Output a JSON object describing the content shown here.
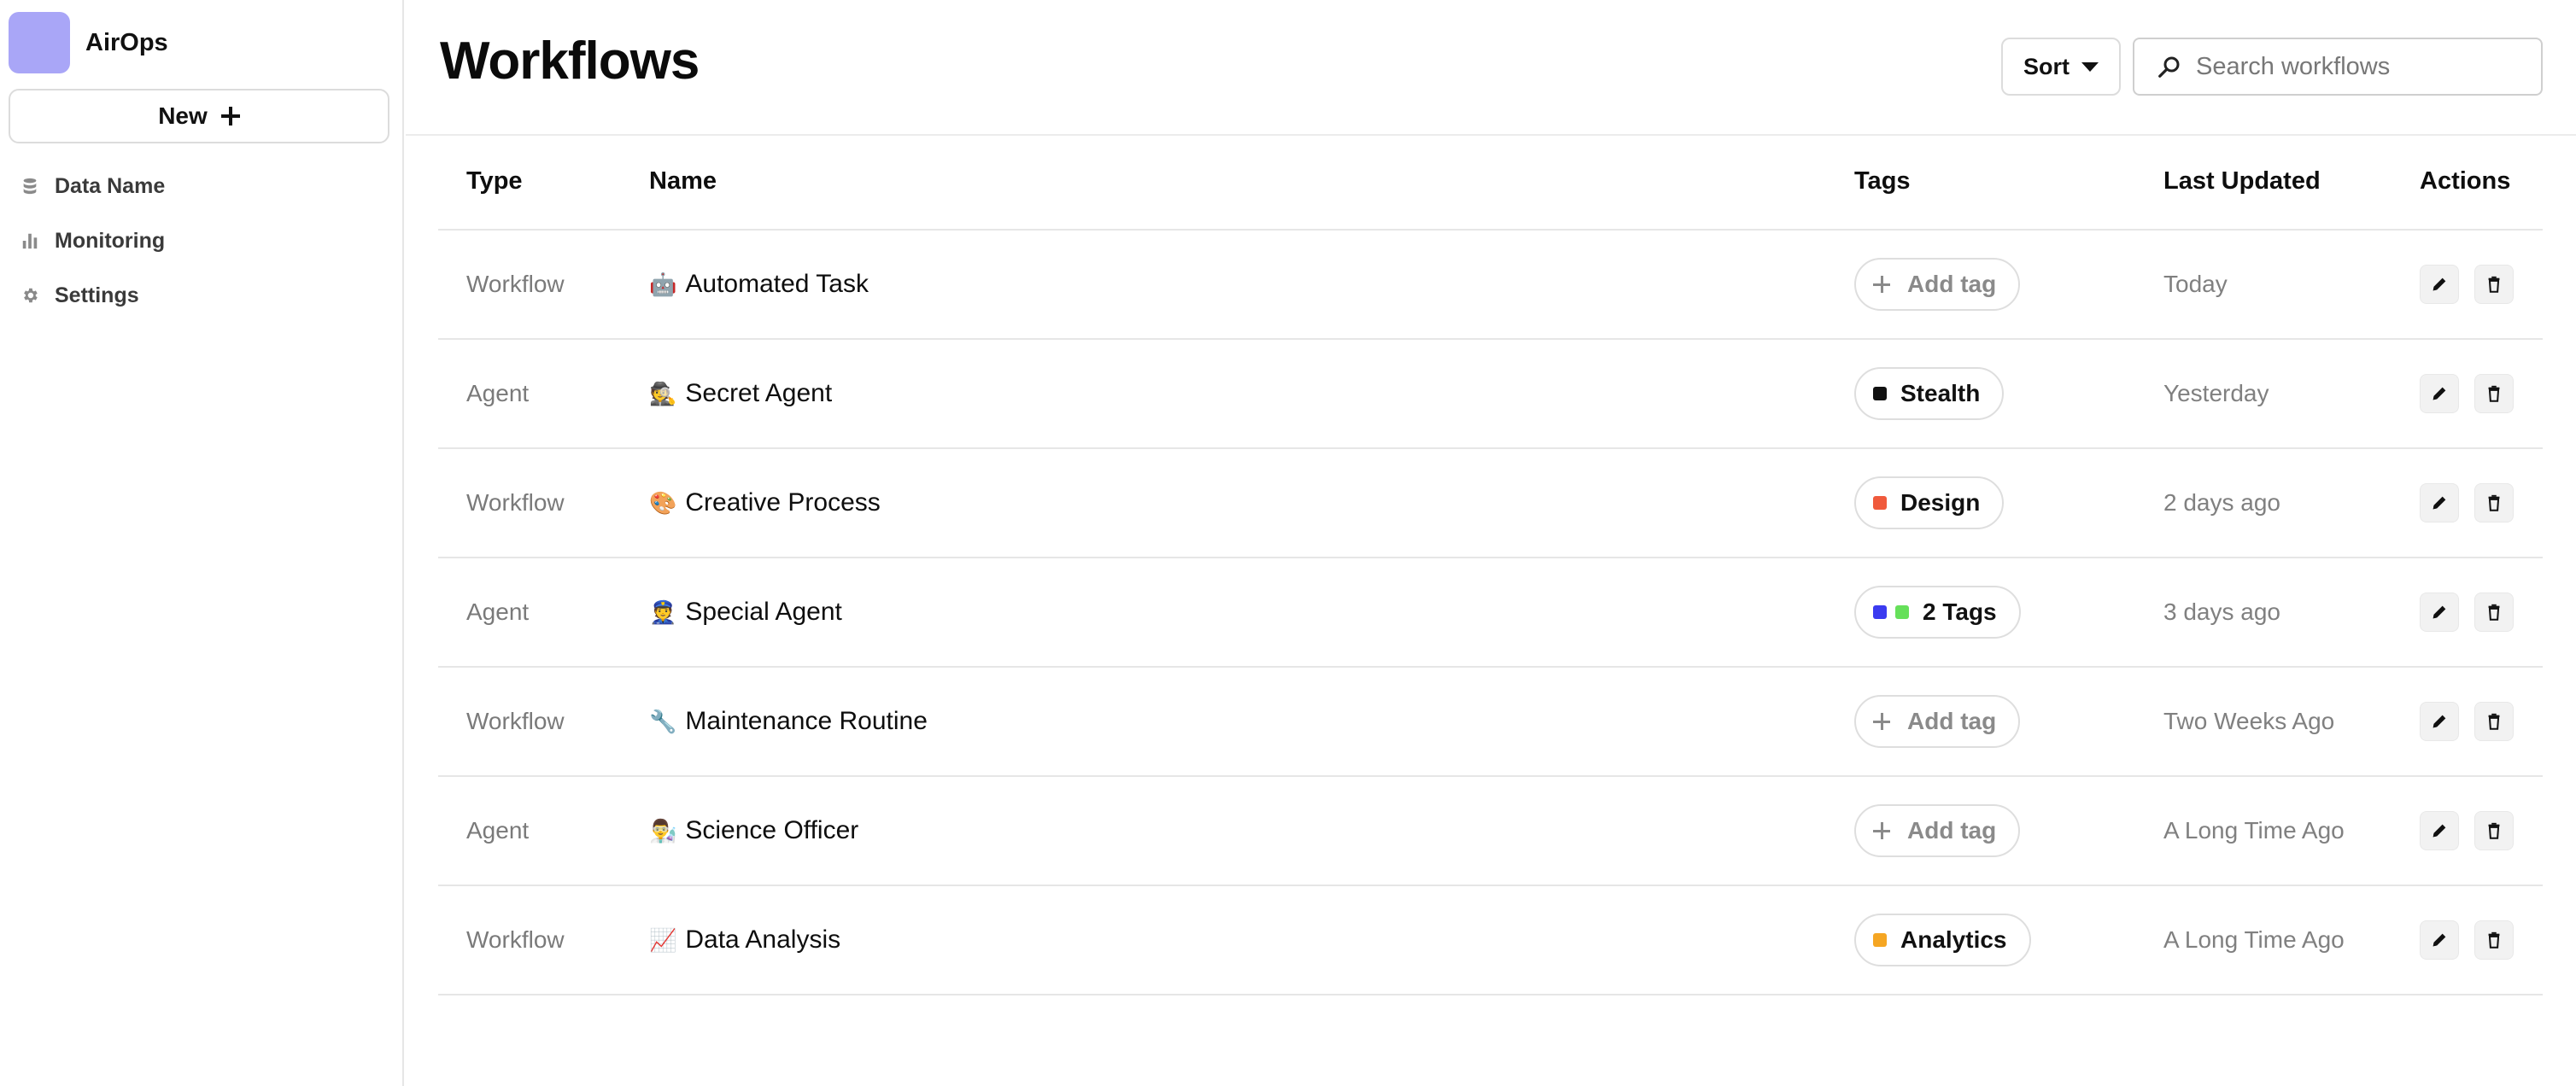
{
  "brand": {
    "name": "AirOps",
    "logo_color": "#a9a6f7"
  },
  "sidebar": {
    "new_label": "New",
    "items": [
      {
        "label": "Data Name",
        "icon": "database-icon"
      },
      {
        "label": "Monitoring",
        "icon": "bar-chart-icon"
      },
      {
        "label": "Settings",
        "icon": "gear-icon"
      }
    ]
  },
  "header": {
    "title": "Workflows",
    "sort_label": "Sort",
    "search_placeholder": "Search workflows"
  },
  "table": {
    "columns": [
      "Type",
      "Name",
      "Tags",
      "Last Updated",
      "Actions"
    ],
    "rows": [
      {
        "type": "Workflow",
        "emoji": "🤖",
        "name": "Automated Task",
        "tag": {
          "kind": "add",
          "label": "Add tag",
          "colors": []
        },
        "updated": "Today"
      },
      {
        "type": "Agent",
        "emoji": "🕵️",
        "name": "Secret Agent",
        "tag": {
          "kind": "tag",
          "label": "Stealth",
          "colors": [
            "#111111"
          ]
        },
        "updated": "Yesterday"
      },
      {
        "type": "Workflow",
        "emoji": "🎨",
        "name": "Creative Process",
        "tag": {
          "kind": "tag",
          "label": "Design",
          "colors": [
            "#f05a3c"
          ]
        },
        "updated": "2 days ago"
      },
      {
        "type": "Agent",
        "emoji": "👮",
        "name": "Special Agent",
        "tag": {
          "kind": "tag",
          "label": "2 Tags",
          "colors": [
            "#3b3bf0",
            "#66e05a"
          ]
        },
        "updated": "3 days ago"
      },
      {
        "type": "Workflow",
        "emoji": "🔧",
        "name": "Maintenance Routine",
        "tag": {
          "kind": "add",
          "label": "Add tag",
          "colors": []
        },
        "updated": "Two Weeks Ago"
      },
      {
        "type": "Agent",
        "emoji": "👨‍🔬",
        "name": "Science Officer",
        "tag": {
          "kind": "add",
          "label": "Add tag",
          "colors": []
        },
        "updated": "A Long Time Ago"
      },
      {
        "type": "Workflow",
        "emoji": "📈",
        "name": "Data Analysis",
        "tag": {
          "kind": "tag",
          "label": "Analytics",
          "colors": [
            "#f5a623"
          ]
        },
        "updated": "A Long Time Ago"
      }
    ],
    "actions": {
      "edit_icon": "pencil-icon",
      "delete_icon": "trash-icon"
    }
  }
}
